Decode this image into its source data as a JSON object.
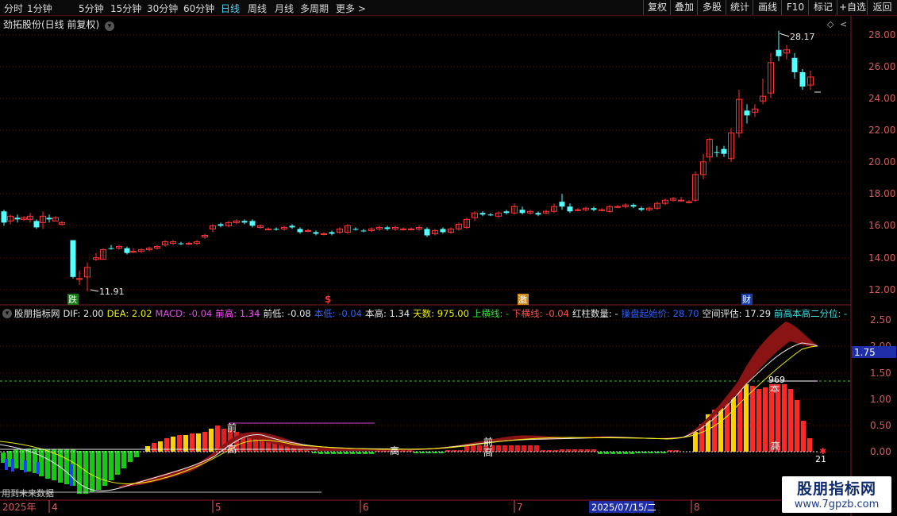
{
  "toolbar": {
    "left": [
      {
        "label": "分时",
        "active": false
      },
      {
        "label": "1分钟",
        "active": false
      },
      {
        "label": "5分钟",
        "active": false
      },
      {
        "label": "15分钟",
        "active": false
      },
      {
        "label": "30分钟",
        "active": false
      },
      {
        "label": "60分钟",
        "active": false
      },
      {
        "label": "日线",
        "active": true
      },
      {
        "label": "周线",
        "active": false
      },
      {
        "label": "月线",
        "active": false
      },
      {
        "label": "多周期",
        "active": false
      },
      {
        "label": "更多",
        "active": false
      }
    ],
    "right": [
      "复权",
      "叠加",
      "多股",
      "统计",
      "画线",
      "F10",
      "标记",
      "+自选",
      "返回"
    ]
  },
  "chart": {
    "title": "劲拓股份(日线 前复权)",
    "price_ticks": [
      "28.00",
      "26.00",
      "24.00",
      "22.00",
      "20.00",
      "18.00",
      "16.00",
      "14.00",
      "12.00"
    ],
    "max_label": "28.17",
    "min_label": "11.91",
    "event_markers": [
      {
        "text": "跌",
        "bg": "#1a7a1a",
        "color": "#ffffff"
      },
      {
        "text": "$",
        "bg": "",
        "color": "#ff3030"
      },
      {
        "text": "激",
        "bg": "#d08a14",
        "color": "#ffffff"
      },
      {
        "text": "财",
        "bg": "#1a3fa8",
        "color": "#ffffff"
      }
    ]
  },
  "indicator": {
    "name": "股朋指标网",
    "legend": [
      {
        "text": "DIF: 2.00",
        "color": "#e8e8e8"
      },
      {
        "text": "DEA: 2.02",
        "color": "#f0f000"
      },
      {
        "text": "MACD: -0.04",
        "color": "#e050e0"
      },
      {
        "text": "前高: 1.34",
        "color": "#ff50ff"
      },
      {
        "text": "前低: -0.08",
        "color": "#e8e8e8"
      },
      {
        "text": "本低: -0.04",
        "color": "#3060ff"
      },
      {
        "text": "本高: 1.34",
        "color": "#e8e8e8"
      },
      {
        "text": "天数: 975.00",
        "color": "#f0f000"
      },
      {
        "text": "上横线: -",
        "color": "#30e030"
      },
      {
        "text": "下横线: -0.04",
        "color": "#ff5050"
      },
      {
        "text": "红柱数量: -",
        "color": "#e8e8e8"
      },
      {
        "text": "操盘起始价: 28.70",
        "color": "#3060ff"
      },
      {
        "text": "空间评估: 17.29",
        "color": "#e8e8e8"
      },
      {
        "text": "前高本高二分位: -",
        "color": "#40e0e0"
      }
    ],
    "ticks": [
      "2.50",
      "2.00",
      "1.50",
      "1.00",
      "0.50",
      "0.00"
    ],
    "current_value": "1.75",
    "labels": {
      "qian": "前",
      "gao": "高",
      "ben": "本",
      "top_value": "969",
      "last_value": "21",
      "future": "用到未来数据"
    }
  },
  "time_axis": {
    "year": "2025年",
    "months": [
      "4",
      "5",
      "6",
      "7",
      "8"
    ],
    "cursor_date": "2025/07/15/二"
  },
  "watermark": {
    "title": "股朋指标网",
    "url": "www.7gpzb.com"
  },
  "colors": {
    "up": "#ff3333",
    "down": "#54ffff",
    "grid": "#5a1010",
    "dif": "#e8e8e8",
    "dea": "#f0f000"
  }
}
